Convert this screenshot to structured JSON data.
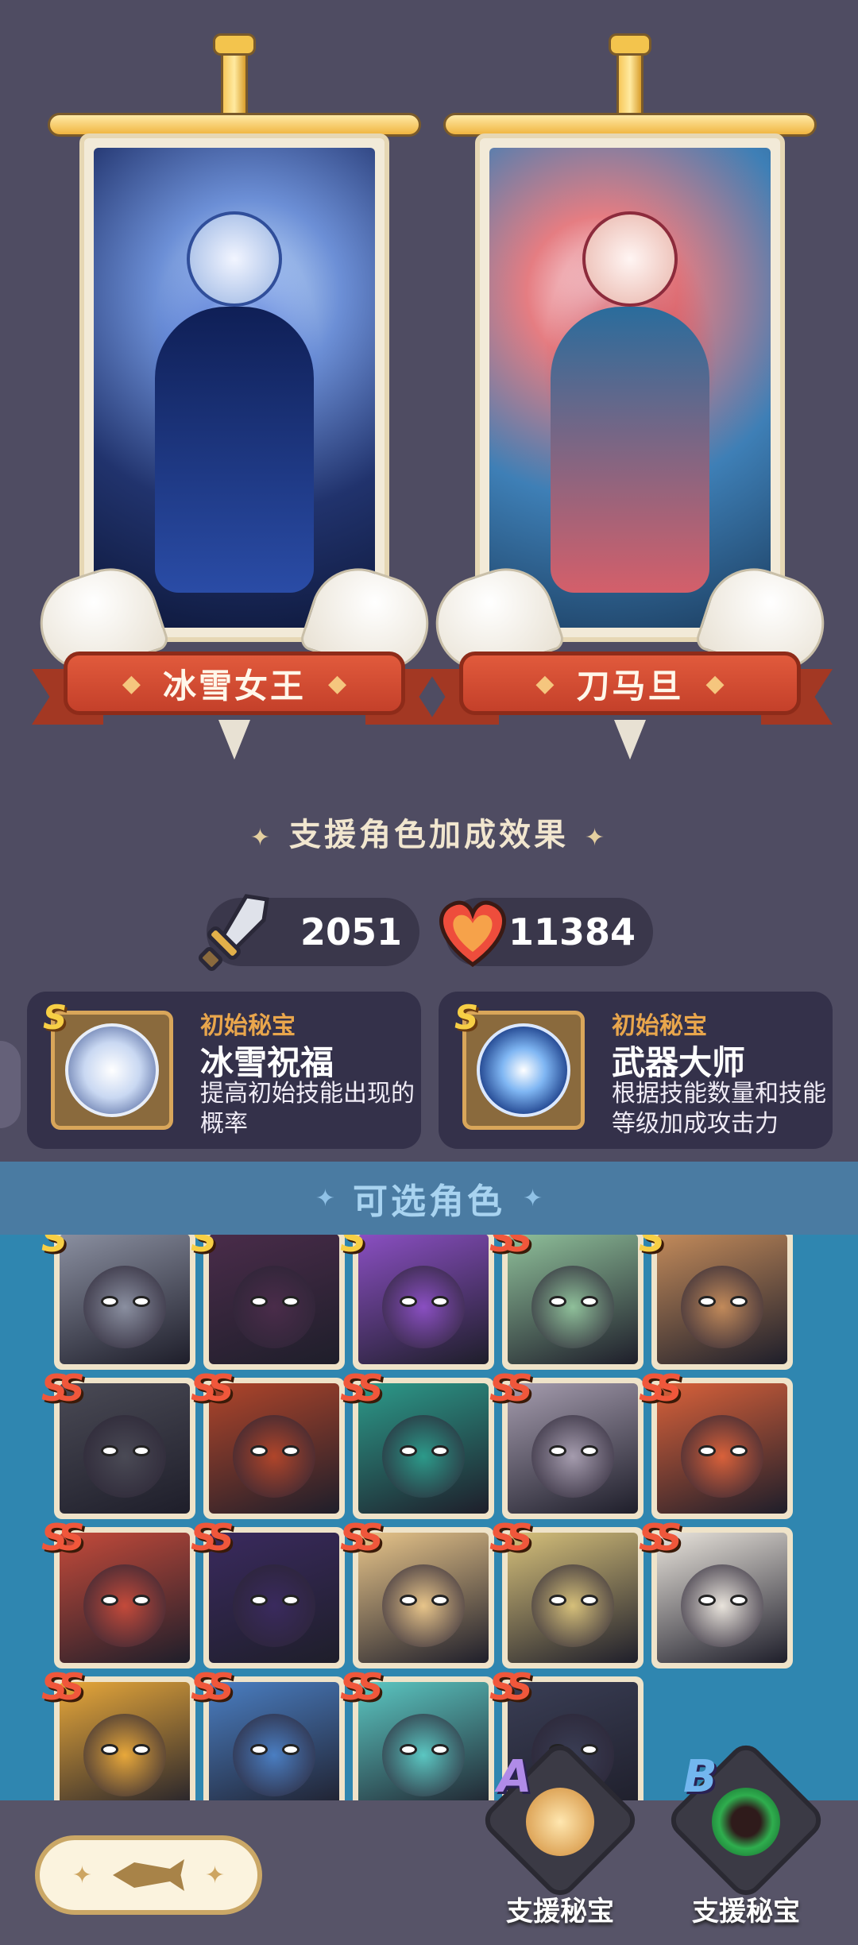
{
  "featured": [
    {
      "name": "冰雪女王"
    },
    {
      "name": "刀马旦"
    }
  ],
  "bonus": {
    "title": "支援角色加成效果",
    "attack": "2051",
    "health": "11384"
  },
  "treasures": [
    {
      "grade": "S",
      "kind": "初始秘宝",
      "name": "冰雪祝福",
      "desc": "提高初始技能出现的概率"
    },
    {
      "grade": "S",
      "kind": "初始秘宝",
      "name": "武器大师",
      "desc": "根据技能数量和技能等级加成攻击力"
    }
  ],
  "roster": {
    "title": "可选角色",
    "characters": [
      {
        "grade": "S",
        "color": "#8a8fa0"
      },
      {
        "grade": "S",
        "color": "#4a2c4a"
      },
      {
        "grade": "S",
        "color": "#8a4fc2"
      },
      {
        "grade": "SS",
        "color": "#8fc09a"
      },
      {
        "grade": "S",
        "color": "#c28a5a"
      },
      {
        "grade": "SS",
        "color": "#4a4a55"
      },
      {
        "grade": "SS",
        "color": "#b0452a"
      },
      {
        "grade": "SS",
        "color": "#2c9a8a"
      },
      {
        "grade": "SS",
        "color": "#a59cae"
      },
      {
        "grade": "SS",
        "color": "#d9613a"
      },
      {
        "grade": "SS",
        "color": "#c44a3a"
      },
      {
        "grade": "SS",
        "color": "#3a2a5e"
      },
      {
        "grade": "SS",
        "color": "#e8c58a"
      },
      {
        "grade": "SS",
        "color": "#d6c07a"
      },
      {
        "grade": "SS",
        "color": "#e9e4dc"
      },
      {
        "grade": "SS",
        "color": "#e8a83a"
      },
      {
        "grade": "SS",
        "color": "#4a7ec2"
      },
      {
        "grade": "SS",
        "color": "#5bc7c2"
      },
      {
        "grade": "SS",
        "color": "#3a3e55"
      }
    ]
  },
  "support_slots": [
    {
      "letter": "A",
      "label": "支援秘宝"
    },
    {
      "letter": "B",
      "label": "支援秘宝"
    }
  ]
}
